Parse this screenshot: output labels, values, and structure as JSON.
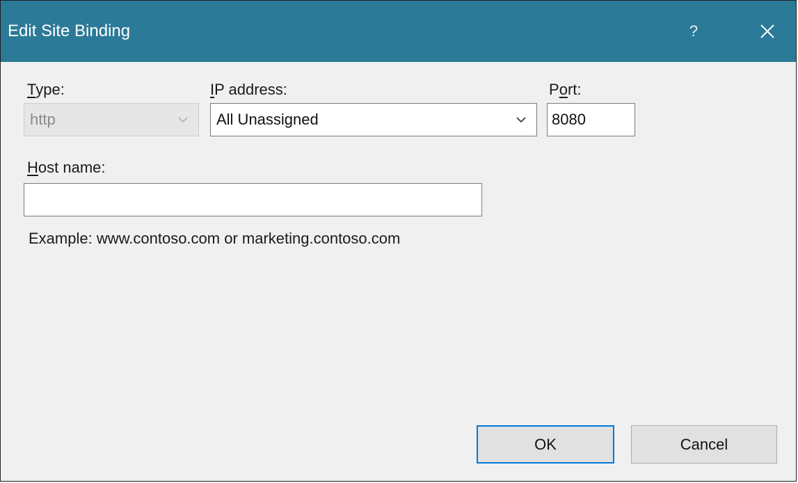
{
  "window": {
    "title": "Edit Site Binding",
    "help_glyph": "?",
    "accent_color": "#2b7a97"
  },
  "type_field": {
    "label_mnemonic": "T",
    "label_rest": "ype:",
    "value": "http",
    "enabled": false
  },
  "ip_field": {
    "label_mnemonic": "I",
    "label_rest": "P address:",
    "value": "All Unassigned"
  },
  "port_field": {
    "label_pre": "P",
    "label_mnemonic": "o",
    "label_rest": "rt:",
    "value": "8080"
  },
  "host_field": {
    "label_mnemonic": "H",
    "label_rest": "ost name:",
    "value": "",
    "example": "Example: www.contoso.com or marketing.contoso.com"
  },
  "buttons": {
    "ok": "OK",
    "cancel": "Cancel",
    "focus_color": "#0078d7"
  },
  "icons": {
    "close": "close-icon",
    "dropdown": "chevron-down-icon"
  }
}
